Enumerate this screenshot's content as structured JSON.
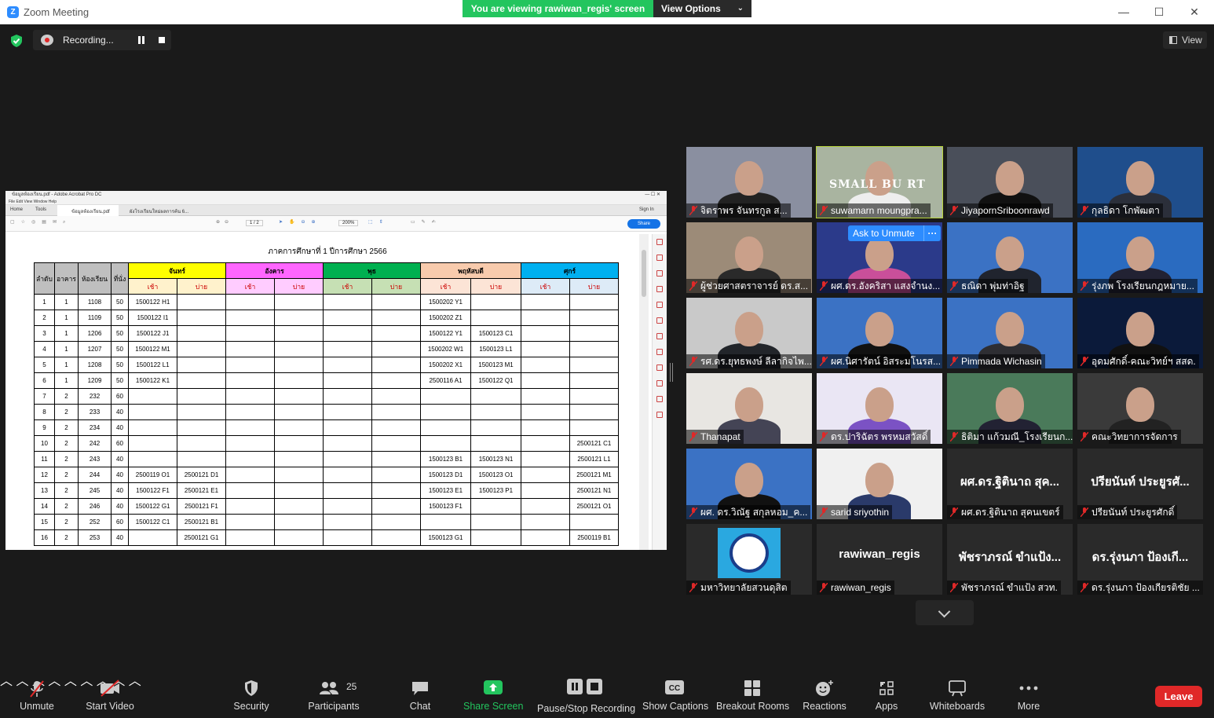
{
  "window": {
    "title": "Zoom Meeting",
    "controls": [
      "—",
      "☐",
      "✕"
    ]
  },
  "banner": {
    "viewing": "You are viewing rawiwan_regis' screen",
    "view_options": "View Options"
  },
  "recording": {
    "label": "Recording..."
  },
  "view_button": {
    "label": "View"
  },
  "shared_screen": {
    "app_title": "ข้อมูลห้องเรียน.pdf - Adobe Acrobat Pro DC",
    "menu": "File   Edit   View   Window   Help",
    "tabs": [
      "Home",
      "Tools",
      "ข้อมูลห้องเรียน.pdf",
      "ผังโรงเรียนใหม่ผลการค้น 6..."
    ],
    "sign_in": "Sign In",
    "page_indicator": "1 / 2",
    "zoom": "200%",
    "share": "Share",
    "doc_title": "ภาคการศึกษาที่ 1 ปีการศึกษา 2566",
    "headers": {
      "order": "ลำดับ",
      "building": "อาคาร",
      "room": "ห้องเรียน",
      "seats": "ที่นั่ง",
      "days": [
        "จันทร์",
        "อังคาร",
        "พุธ",
        "พฤหัสบดี",
        "ศุกร์"
      ],
      "am": "เช้า",
      "pm": "บ่าย"
    },
    "day_colors": [
      [
        "#ffff00",
        "#fff2cc"
      ],
      [
        "#ff66ff",
        "#ffccff"
      ],
      [
        "#00b050",
        "#c6e0b4"
      ],
      [
        "#f8cbad",
        "#fce4d6"
      ],
      [
        "#00b0f0",
        "#ddebf7"
      ]
    ],
    "rows": [
      [
        "1",
        "1",
        "1108",
        "50",
        "1500122 H1",
        "",
        "",
        "",
        "",
        "",
        "1500202 Y1",
        "",
        "",
        ""
      ],
      [
        "2",
        "1",
        "1109",
        "50",
        "1500122 I1",
        "",
        "",
        "",
        "",
        "",
        "1500202 Z1",
        "",
        "",
        ""
      ],
      [
        "3",
        "1",
        "1206",
        "50",
        "1500122 J1",
        "",
        "",
        "",
        "",
        "",
        "1500122 Y1",
        "1500123 C1",
        "",
        ""
      ],
      [
        "4",
        "1",
        "1207",
        "50",
        "1500122 M1",
        "",
        "",
        "",
        "",
        "",
        "1500202 W1",
        "1500123 L1",
        "",
        ""
      ],
      [
        "5",
        "1",
        "1208",
        "50",
        "1500122 L1",
        "",
        "",
        "",
        "",
        "",
        "1500202 X1",
        "1500123 M1",
        "",
        ""
      ],
      [
        "6",
        "1",
        "1209",
        "50",
        "1500122 K1",
        "",
        "",
        "",
        "",
        "",
        "2500116 A1",
        "1500122 Q1",
        "",
        ""
      ],
      [
        "7",
        "2",
        "232",
        "60",
        "",
        "",
        "",
        "",
        "",
        "",
        "",
        "",
        "",
        ""
      ],
      [
        "8",
        "2",
        "233",
        "40",
        "",
        "",
        "",
        "",
        "",
        "",
        "",
        "",
        "",
        ""
      ],
      [
        "9",
        "2",
        "234",
        "40",
        "",
        "",
        "",
        "",
        "",
        "",
        "",
        "",
        "",
        ""
      ],
      [
        "10",
        "2",
        "242",
        "60",
        "",
        "",
        "",
        "",
        "",
        "",
        "",
        "",
        "",
        "2500121 C1"
      ],
      [
        "11",
        "2",
        "243",
        "40",
        "",
        "",
        "",
        "",
        "",
        "",
        "1500123 B1",
        "1500123 N1",
        "",
        "2500121 L1"
      ],
      [
        "12",
        "2",
        "244",
        "40",
        "2500119 O1",
        "2500121 D1",
        "",
        "",
        "",
        "",
        "1500123 D1",
        "1500123 O1",
        "",
        "2500121 M1"
      ],
      [
        "13",
        "2",
        "245",
        "40",
        "1500122 F1",
        "2500121 E1",
        "",
        "",
        "",
        "",
        "1500123 E1",
        "1500123 P1",
        "",
        "2500121 N1"
      ],
      [
        "14",
        "2",
        "246",
        "40",
        "1500122 G1",
        "2500121 F1",
        "",
        "",
        "",
        "",
        "1500123 F1",
        "",
        "",
        "2500121 O1"
      ],
      [
        "15",
        "2",
        "252",
        "60",
        "1500122 C1",
        "2500121 B1",
        "",
        "",
        "",
        "",
        "",
        "",
        "",
        ""
      ],
      [
        "16",
        "2",
        "253",
        "40",
        "",
        "2500121 G1",
        "",
        "",
        "",
        "",
        "1500123 G1",
        "",
        "",
        "2500119 B1"
      ]
    ]
  },
  "ask_to_unmute": "Ask to Unmute",
  "participants": [
    {
      "name": "จิตราพร จันทรกูล ส...",
      "type": "video"
    },
    {
      "name": "suwamarn moungpra...",
      "type": "video",
      "overlay": "SMALL BU    RT"
    },
    {
      "name": "JiyapornSriboonrawd",
      "type": "video"
    },
    {
      "name": "กุลธิดา โกพัฒตา",
      "type": "video"
    },
    {
      "name": "ผู้ช่วยศาสตราจารย์ ดร.ส...",
      "type": "video"
    },
    {
      "name": "ผศ.ดร.อังคริสา แสงจำนง...",
      "type": "video"
    },
    {
      "name": "ธณิดา พุ่มท่าอิฐ",
      "type": "video"
    },
    {
      "name": "รุ่งภพ โรงเรียนกฎหมาย...",
      "type": "video"
    },
    {
      "name": "รศ.ดร.ยุทธพงษ์ ลีลากิจไพ...",
      "type": "video"
    },
    {
      "name": "ผศ.นิศารัตน์ อิสระมโนรส...",
      "type": "video"
    },
    {
      "name": "Pimmada Wichasin",
      "type": "video"
    },
    {
      "name": "อุดมศักดิ์-คณะวิทย์ฯ สสด.",
      "type": "video"
    },
    {
      "name": "Thanapat",
      "type": "video"
    },
    {
      "name": "ดร.ปาริฉัตร พรหมสวัสดิ์",
      "type": "video"
    },
    {
      "name": "ธิติมา แก้วมณี_โรงเรียนก...",
      "type": "video"
    },
    {
      "name": "คณะวิทยาการจัดการ",
      "type": "video"
    },
    {
      "name": "ผศ. ดร.วิณัฐ สกุลหอม_ค...",
      "type": "video"
    },
    {
      "name": "sarid sriyothin",
      "type": "video"
    },
    {
      "name": "ผศ.ดร.ฐิตินาถ สุคนเขตร์",
      "type": "text",
      "big": "ผศ.ดร.ฐิตินาถ สุค..."
    },
    {
      "name": "ปรียนันท์ ประยูรศักดิ์",
      "type": "text",
      "big": "ปรียนันท์ ประยูรศั..."
    },
    {
      "name": "มหาวิทยาลัยสวนดุสิต",
      "type": "logo"
    },
    {
      "name": "rawiwan_regis",
      "type": "text",
      "big": "rawiwan_regis"
    },
    {
      "name": "พัชราภรณ์ ขำแป้ง สวท.",
      "type": "text",
      "big": "พัชราภรณ์ ขำแป้ง..."
    },
    {
      "name": "ดร.รุ่งนภา ป้องเกียรติชัย ...",
      "type": "text",
      "big": "ดร.รุ่งนภา ป้องเกี..."
    }
  ],
  "toolbar": {
    "unmute": "Unmute",
    "start_video": "Start Video",
    "security": "Security",
    "participants": "Participants",
    "participants_count": "25",
    "chat": "Chat",
    "share_screen": "Share Screen",
    "pause_stop": "Pause/Stop Recording",
    "captions": "Show Captions",
    "breakout": "Breakout Rooms",
    "reactions": "Reactions",
    "apps": "Apps",
    "whiteboards": "Whiteboards",
    "more": "More",
    "leave": "Leave"
  },
  "colors": {
    "share_green": "#23c55e",
    "zoom_blue": "#2d8cff",
    "leave_red": "#e02828"
  }
}
